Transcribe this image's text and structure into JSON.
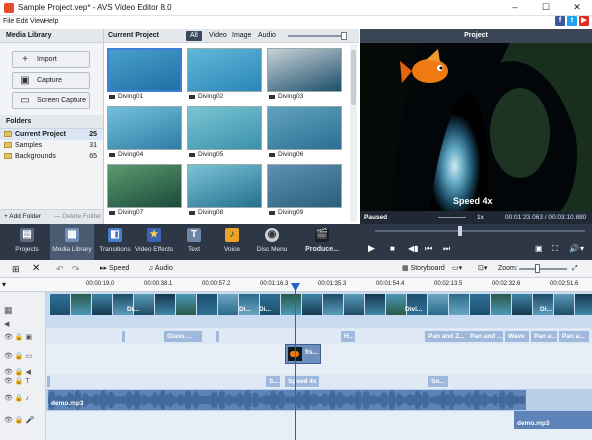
{
  "window": {
    "title": "Sample Project.vep* - AVS Video Editor 8.0",
    "minimize": "–",
    "maximize": "☐",
    "close": "✕"
  },
  "menu": [
    "File",
    "Edit",
    "View",
    "Help"
  ],
  "social": [
    "f",
    "t",
    "▶"
  ],
  "media_library": {
    "title": "Media Library",
    "buttons": [
      "Import",
      "Capture",
      "Screen Capture"
    ],
    "folders_title": "Folders",
    "folders": [
      {
        "name": "Current Project",
        "count": "25"
      },
      {
        "name": "Samples",
        "count": "31"
      },
      {
        "name": "Backgrounds",
        "count": "65"
      }
    ],
    "add_folder": "+ Add Folder",
    "delete_folder": "— Delete Folder"
  },
  "project": {
    "title": "Current Project",
    "tabs": [
      "All",
      "Video",
      "Image",
      "Audio"
    ],
    "active_tab": "All",
    "thumbnails": [
      "Diving01",
      "Diving02",
      "Diving03",
      "Diving04",
      "Diving05",
      "Diving06",
      "Diving07",
      "Diving08",
      "Diving09"
    ],
    "selected": "Diving01"
  },
  "preview": {
    "title": "Project",
    "overlay_text": "Speed 4x",
    "status": "Paused",
    "speed": "1x",
    "time": "00:01:23.063 / 00:03:10.880"
  },
  "toolbar": {
    "items": [
      "Projects",
      "Media Library",
      "Transitions",
      "Video Effects",
      "Text",
      "Voice",
      "Disc Menu",
      "Produce..."
    ],
    "active": "Media Library"
  },
  "timeline_tools": {
    "speed": "Speed",
    "audio": "Audio",
    "storyboard": "Storyboard",
    "zoom": "Zoom:"
  },
  "ruler_ticks": [
    "00:00:19.0",
    "00:00:38.1",
    "00:00:57.2",
    "00:01:16.3",
    "00:01:35.3",
    "00:01:54.4",
    "00:02:13.5",
    "00:02:32.6",
    "00:02:51.6"
  ],
  "tracks": {
    "video_clips": [
      "Di...",
      "Di...",
      "Di...",
      "Divi...",
      "Di..."
    ],
    "effect_clips": [
      "Glass ...",
      "H...",
      "Pan and Z...",
      "Pan and ...",
      "Wave",
      "Pan a...",
      "Pan a..."
    ],
    "overlay_clip": "fis...",
    "text_clips": [
      "S...",
      "Speed 4x",
      "So..."
    ],
    "audio_clips": [
      "demo.mp3",
      "demo.mp3"
    ]
  },
  "colors": {
    "accent": "#3f7fd9",
    "dark_panel": "#2d3745",
    "timeline": "#dfe9f6"
  }
}
